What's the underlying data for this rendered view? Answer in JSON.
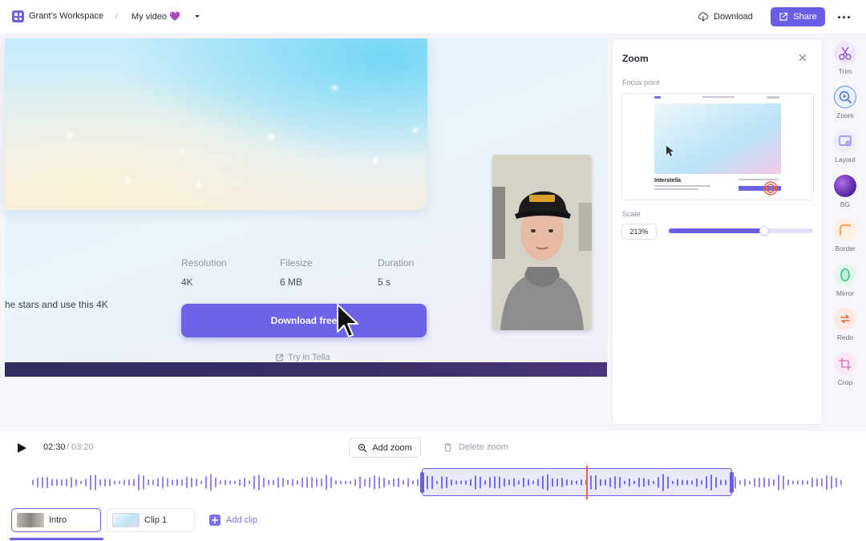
{
  "topbar": {
    "workspace_name": "Grant’s Workspace",
    "separator": "/",
    "video_title": "My video 💜",
    "download_label": "Download",
    "share_label": "Share"
  },
  "stage": {
    "stats": [
      {
        "label": "Resolution",
        "value": "4K"
      },
      {
        "label": "Filesize",
        "value": "6 MB"
      },
      {
        "label": "Duration",
        "value": "5 s"
      }
    ],
    "description": "he stars and use this 4K",
    "download_free_label": "Download free",
    "try_label": "Try in Tella"
  },
  "zoom_panel": {
    "title": "Zoom",
    "focus_point_label": "Focus point",
    "preview_heading": "Interstella",
    "scale_label": "Scale",
    "scale_value": "213%",
    "scale_fraction": 0.66
  },
  "toolbar": [
    {
      "name": "trim",
      "label": "Trim",
      "color": "#c7a7f0"
    },
    {
      "name": "zoom",
      "label": "Zoom",
      "color": "#6a8fe0"
    },
    {
      "name": "layout",
      "label": "Layout",
      "color": "#b7b4f2"
    },
    {
      "name": "bg",
      "label": "BG",
      "color": "#5b2ea8"
    },
    {
      "name": "border",
      "label": "Border",
      "color": "#f2a65f"
    },
    {
      "name": "mirror",
      "label": "Mirror",
      "color": "#3fbf8c"
    },
    {
      "name": "redo",
      "label": "Redo",
      "color": "#e8643e"
    },
    {
      "name": "crop",
      "label": "Crop",
      "color": "#e07ac6"
    }
  ],
  "timeline": {
    "current_time": "02:30",
    "total_time": "/ 03:20",
    "add_zoom_label": "Add zoom",
    "delete_zoom_label": "Delete zoom",
    "clips": [
      {
        "label": "Intro",
        "active": true
      },
      {
        "label": "Clip 1",
        "active": false
      }
    ],
    "add_clip_label": "Add clip"
  },
  "colors": {
    "accent": "#6a5ee6",
    "playhead": "#ee6548"
  }
}
